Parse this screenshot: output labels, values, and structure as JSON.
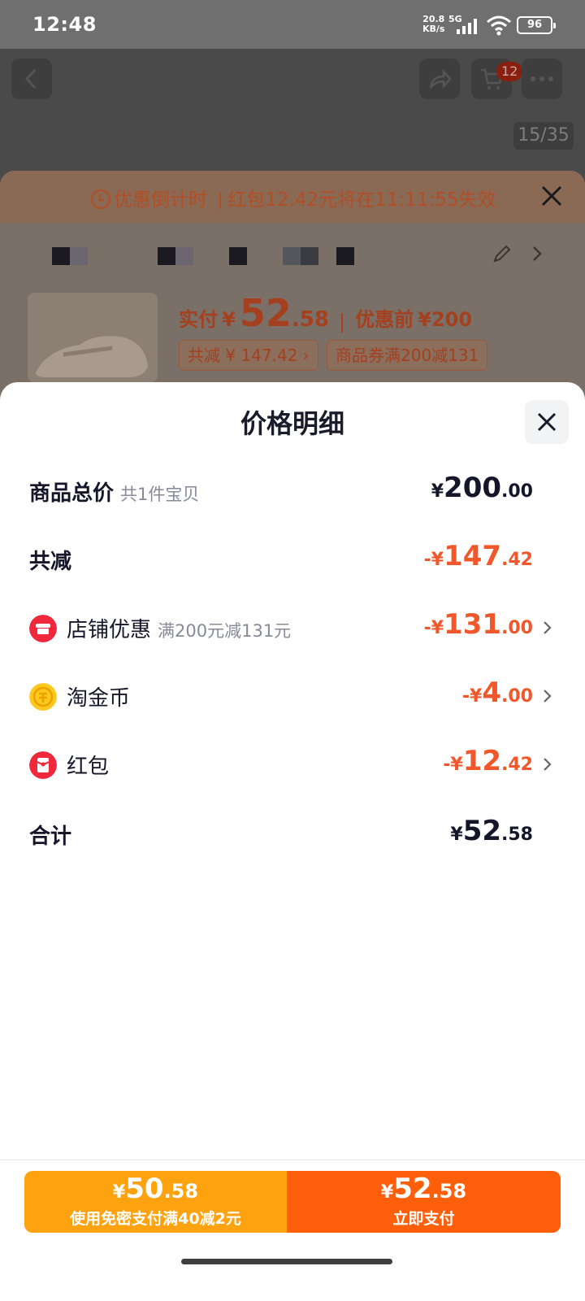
{
  "status_bar": {
    "time": "12:48",
    "net_speed": "20.8",
    "net_unit": "KB/s",
    "net_type": "5G",
    "battery": "96"
  },
  "product_page": {
    "cart_badge": "12",
    "image_counter": "15/35",
    "countdown_label": "优惠倒计时",
    "countdown_text": "红包12.42元将在11:11:55失效",
    "pay_label": "实付",
    "pay_currency": "¥",
    "pay_int": "52",
    "pay_dec": ".58",
    "before_label": "优惠前",
    "before_price": "¥200",
    "saved_chip": "共减 ¥ 147.42",
    "coupon_chip": "商品券满200减131"
  },
  "detail": {
    "title": "价格明细",
    "rows": [
      {
        "label": "商品总价",
        "sub": "共1件宝贝",
        "sign": "",
        "int": "200",
        "dec": ".00"
      },
      {
        "label": "共减",
        "sub": "",
        "sign": "-",
        "int": "147",
        "dec": ".42"
      },
      {
        "label": "店铺优惠",
        "sub": "满200元减131元",
        "sign": "-",
        "int": "131",
        "dec": ".00",
        "icon": "shop-icon"
      },
      {
        "label": "淘金币",
        "sub": "",
        "sign": "-",
        "int": "4",
        "dec": ".00",
        "icon": "coin-icon"
      },
      {
        "label": "红包",
        "sub": "",
        "sign": "-",
        "int": "12",
        "dec": ".42",
        "icon": "red-packet-icon"
      },
      {
        "label": "合计",
        "sub": "",
        "sign": "",
        "int": "52",
        "dec": ".58"
      }
    ],
    "currency": "¥"
  },
  "bottom": {
    "left_int": "50",
    "left_dec": ".58",
    "left_caption": "使用免密支付满40减2元",
    "right_int": "52",
    "right_dec": ".58",
    "right_caption": "立即支付"
  },
  "colors": {
    "discount": "#f0572b",
    "pay_left": "#ffa20f",
    "pay_right": "#ff5f0a"
  }
}
